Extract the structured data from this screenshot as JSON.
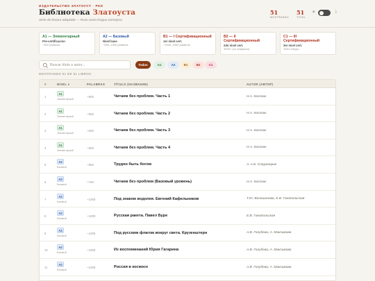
{
  "header": {
    "eyebrow": "ИЗДАТЕЛЬСТВО ЗЛАТОУСТ · РКИ",
    "title_main": "Библиотека ",
    "title_accent": "Златоуста",
    "subtitle": "Serie de lectura adaptada — Ruso como lengua extranjera",
    "stats": [
      {
        "value": "51",
        "label": "MOSTRANDO"
      },
      {
        "value": "51",
        "label": "TOTAL"
      }
    ],
    "theme_light_icon": "☀",
    "theme_dark_icon": "☽"
  },
  "level_cards": [
    {
      "title": "A1 — Элементарный",
      "sub": "Pre-certificacion",
      "note": "~500 palabras",
      "color": "#2f7d3f"
    },
    {
      "title": "A2 — Базовый",
      "sub": "Nivel base",
      "note": "~650–1300 palabras",
      "color": "#2c5aa0"
    },
    {
      "title": "B1 — I Сертификационный",
      "sub": "1er nivel cert.",
      "note": "~1500–2300 palabras",
      "color": "#b0321f"
    },
    {
      "title": "B2 — II Сертификационный",
      "sub": "2do nivel cert.",
      "note": "3000+ (no adaptado)",
      "color": "#b0321f"
    },
    {
      "title": "C1 — III Сертификационный",
      "sub": "3er nivel cert.",
      "note": "Texto integro",
      "color": "#b0321f"
    }
  ],
  "search": {
    "placeholder": "Buscar título o autor..."
  },
  "filters": [
    {
      "label": "Todos",
      "bg": "#8a3a14",
      "fg": "#ffffff",
      "active": true
    },
    {
      "label": "A1",
      "bg": "#e4f1e6",
      "fg": "#2f7d3f"
    },
    {
      "label": "A2",
      "bg": "#e3ecf8",
      "fg": "#2c5aa0"
    },
    {
      "label": "B1",
      "bg": "#fbefd9",
      "fg": "#a8641a"
    },
    {
      "label": "B2",
      "bg": "#fbe3df",
      "fg": "#b0321f"
    },
    {
      "label": "C1",
      "bg": "#fbe0e3",
      "fg": "#b02a3a"
    }
  ],
  "showing_text": "MOSTRANDO 51 DE 51 LIBROS",
  "table": {
    "columns": {
      "num": "#",
      "level": "NIVEL ▾",
      "words": "PALABRAS",
      "title": "TÍTULO (НАЗВАНИЕ)",
      "author": "AUTOR (АВТОР)"
    },
    "rows": [
      {
        "n": "1",
        "level": "A1",
        "level_name": "Элементарный",
        "words": "~500",
        "title": "Читаем без проблем. Часть 1",
        "author": "Н.А. Костюк"
      },
      {
        "n": "2",
        "level": "A1",
        "level_name": "Элементарный",
        "words": "~500",
        "title": "Читаем без проблем. Часть 2",
        "author": "Н.А. Костюк"
      },
      {
        "n": "3",
        "level": "A1",
        "level_name": "Элементарный",
        "words": "~500",
        "title": "Читаем без проблем. Часть 3",
        "author": "Н.А. Костюк"
      },
      {
        "n": "4",
        "level": "A1",
        "level_name": "Элементарный",
        "words": "~500",
        "title": "Читаем без проблем. Часть 4",
        "author": "Н.А. Костюк"
      },
      {
        "n": "5",
        "level": "A2",
        "level_name": "Базовый",
        "words": "~650",
        "title": "Трудно быть богом",
        "author": "А. и Б. Стругацкие"
      },
      {
        "n": "6",
        "level": "A2",
        "level_name": "Базовый",
        "words": "~760",
        "title": "Читаем без проблем (Базовый уровень)",
        "author": "Н.А. Костюк"
      },
      {
        "n": "7",
        "level": "A2",
        "level_name": "Базовый",
        "words": "~1300",
        "title": "Под знаком водолея. Евгений Кафельников",
        "author": "Т.Ю. Волошинова, Е.В. Ганапольская"
      },
      {
        "n": "8",
        "level": "A2",
        "level_name": "Базовый",
        "words": "~1300",
        "title": "Русская ракета. Павел Буре",
        "author": "Е.В. Ганапольская"
      },
      {
        "n": "9",
        "level": "A2",
        "level_name": "Базовый",
        "words": "~1300",
        "title": "Под русским флагом вокруг света. Крузенштерн",
        "author": "А.В. Голубева, А. Максимова"
      },
      {
        "n": "10",
        "level": "A2",
        "level_name": "Базовый",
        "words": "~1300",
        "title": "Из воспоминаний Юрия Гагарина",
        "author": "А.В. Голубева, А. Максимова"
      },
      {
        "n": "11",
        "level": "A2",
        "level_name": "Базовый",
        "words": "~1300",
        "title": "Россия в космосе",
        "author": "А.В. Голубева, А. Максимова"
      }
    ]
  }
}
